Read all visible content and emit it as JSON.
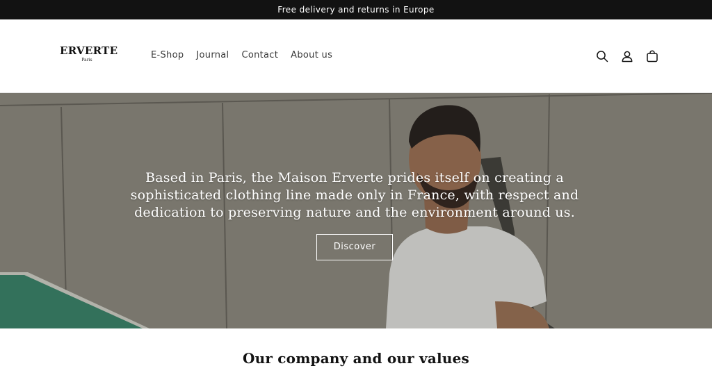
{
  "announcement": {
    "text": "Free delivery and returns in Europe"
  },
  "header": {
    "logo": {
      "name": "ERVERTE",
      "subtitle": "Paris"
    },
    "nav": [
      {
        "label": "E-Shop"
      },
      {
        "label": "Journal"
      },
      {
        "label": "Contact"
      },
      {
        "label": "About us"
      }
    ],
    "icons": [
      "search-icon",
      "account-icon",
      "cart-icon"
    ]
  },
  "hero": {
    "text": "Based in Paris, the Maison Erverte prides itself on creating a sophisticated clothing line made only in France, with respect and dedication to preserving nature and the environment around us.",
    "button_label": "Discover"
  },
  "section": {
    "title": "Our company and our values"
  },
  "colors": {
    "announcement_bg": "#121212",
    "text": "#121212",
    "hero_text": "#ffffff"
  }
}
